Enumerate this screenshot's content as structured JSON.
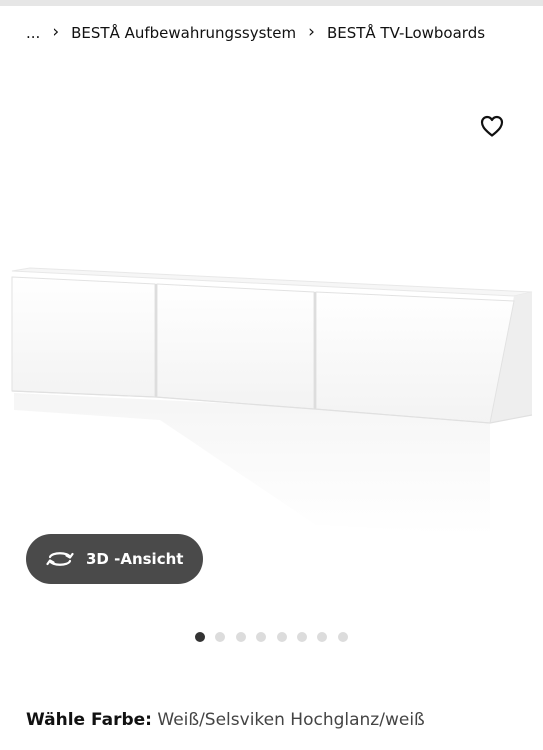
{
  "breadcrumb": {
    "ellipsis": "...",
    "items": [
      "BESTÅ Aufbewahrungssystem",
      "BESTÅ TV-Lowboards"
    ]
  },
  "icons": {
    "favorite": "heart-icon",
    "rotate": "rotate-3d-icon",
    "separator": "chevron-right-icon"
  },
  "product_image": {
    "alt": "BESTÅ TV-Lowboard, Weiß/Selsviken Hochglanz/weiß"
  },
  "viewer": {
    "button_label": "3D -Ansicht"
  },
  "carousel": {
    "total": 8,
    "active_index": 0
  },
  "color": {
    "label": "Wähle Farbe:",
    "value": "Weiß/Selsviken Hochglanz/weiß"
  },
  "colors": {
    "button_bg": "#4a4a4a",
    "dot_active": "#333333",
    "dot_inactive": "#dcdcdc"
  }
}
